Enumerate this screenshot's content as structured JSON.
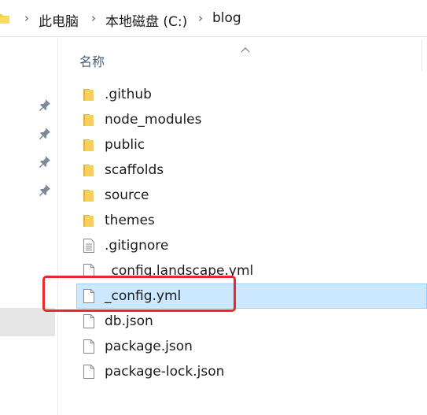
{
  "breadcrumb": {
    "items": [
      "此电脑",
      "本地磁盘 (C:)",
      "blog"
    ],
    "separator": "›"
  },
  "list": {
    "column_name": "名称",
    "files": [
      {
        "name": ".github",
        "type": "folder"
      },
      {
        "name": "node_modules",
        "type": "folder"
      },
      {
        "name": "public",
        "type": "folder"
      },
      {
        "name": "scaffolds",
        "type": "folder"
      },
      {
        "name": "source",
        "type": "folder"
      },
      {
        "name": "themes",
        "type": "folder"
      },
      {
        "name": ".gitignore",
        "type": "text-file"
      },
      {
        "name": "_config.landscape.yml",
        "type": "file"
      },
      {
        "name": "_config.yml",
        "type": "file",
        "selected": true
      },
      {
        "name": "db.json",
        "type": "file"
      },
      {
        "name": "package.json",
        "type": "file"
      },
      {
        "name": "package-lock.json",
        "type": "file"
      }
    ]
  },
  "colors": {
    "selection_bg": "#cce8ff",
    "selection_border": "#99d1ff",
    "annotation": "#e8282b",
    "folder": "#f4c94f"
  }
}
